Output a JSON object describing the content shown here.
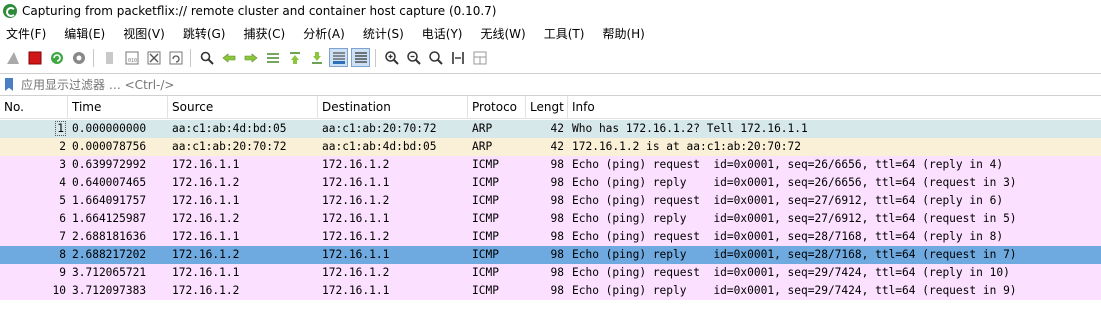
{
  "window": {
    "title": "Capturing from packetflix:// remote cluster and container host capture (0.10.7)"
  },
  "menu": [
    "文件(F)",
    "编辑(E)",
    "视图(V)",
    "跳转(G)",
    "捕获(C)",
    "分析(A)",
    "统计(S)",
    "电话(Y)",
    "无线(W)",
    "工具(T)",
    "帮助(H)"
  ],
  "toolbar": {
    "icons": [
      "shark-fin-start-icon",
      "stop-capture-icon",
      "restart-capture-icon",
      "capture-options-icon",
      "open-file-icon",
      "save-file-icon",
      "close-file-icon",
      "reload-file-icon",
      "find-packet-icon",
      "go-back-icon",
      "go-forward-icon",
      "go-to-packet-icon",
      "first-packet-icon",
      "last-packet-icon",
      "autoscroll-icon",
      "colorize-icon",
      "zoom-in-icon",
      "zoom-out-icon",
      "normal-size-icon",
      "resize-columns-icon",
      "layout-icon"
    ]
  },
  "filter": {
    "placeholder": "应用显示过滤器 … <Ctrl-/>"
  },
  "columns": {
    "no": "No.",
    "time": "Time",
    "source": "Source",
    "destination": "Destination",
    "protocol": "Protoco",
    "length": "Lengt",
    "info": "Info"
  },
  "packets": [
    {
      "no": "1",
      "time": "0.000000000",
      "source": "aa:c1:ab:4d:bd:05",
      "destination": "aa:c1:ab:20:70:72",
      "protocol": "ARP",
      "length": "42",
      "info": "Who has 172.16.1.2? Tell 172.16.1.1"
    },
    {
      "no": "2",
      "time": "0.000078756",
      "source": "aa:c1:ab:20:70:72",
      "destination": "aa:c1:ab:4d:bd:05",
      "protocol": "ARP",
      "length": "42",
      "info": "172.16.1.2 is at aa:c1:ab:20:70:72"
    },
    {
      "no": "3",
      "time": "0.639972992",
      "source": "172.16.1.1",
      "destination": "172.16.1.2",
      "protocol": "ICMP",
      "length": "98",
      "info": "Echo (ping) request  id=0x0001, seq=26/6656, ttl=64 (reply in 4)"
    },
    {
      "no": "4",
      "time": "0.640007465",
      "source": "172.16.1.2",
      "destination": "172.16.1.1",
      "protocol": "ICMP",
      "length": "98",
      "info": "Echo (ping) reply    id=0x0001, seq=26/6656, ttl=64 (request in 3)"
    },
    {
      "no": "5",
      "time": "1.664091757",
      "source": "172.16.1.1",
      "destination": "172.16.1.2",
      "protocol": "ICMP",
      "length": "98",
      "info": "Echo (ping) request  id=0x0001, seq=27/6912, ttl=64 (reply in 6)"
    },
    {
      "no": "6",
      "time": "1.664125987",
      "source": "172.16.1.2",
      "destination": "172.16.1.1",
      "protocol": "ICMP",
      "length": "98",
      "info": "Echo (ping) reply    id=0x0001, seq=27/6912, ttl=64 (request in 5)"
    },
    {
      "no": "7",
      "time": "2.688181636",
      "source": "172.16.1.1",
      "destination": "172.16.1.2",
      "protocol": "ICMP",
      "length": "98",
      "info": "Echo (ping) request  id=0x0001, seq=28/7168, ttl=64 (reply in 8)"
    },
    {
      "no": "8",
      "time": "2.688217202",
      "source": "172.16.1.2",
      "destination": "172.16.1.1",
      "protocol": "ICMP",
      "length": "98",
      "info": "Echo (ping) reply    id=0x0001, seq=28/7168, ttl=64 (request in 7)"
    },
    {
      "no": "9",
      "time": "3.712065721",
      "source": "172.16.1.1",
      "destination": "172.16.1.2",
      "protocol": "ICMP",
      "length": "98",
      "info": "Echo (ping) request  id=0x0001, seq=29/7424, ttl=64 (reply in 10)"
    },
    {
      "no": "10",
      "time": "3.712097383",
      "source": "172.16.1.2",
      "destination": "172.16.1.1",
      "protocol": "ICMP",
      "length": "98",
      "info": "Echo (ping) reply    id=0x0001, seq=29/7424, ttl=64 (request in 9)"
    }
  ],
  "colors": {
    "arp_request": "#d6e8ea",
    "arp_reply": "#faf0d7",
    "icmp": "#fce0ff",
    "selected": "#6eaadf"
  }
}
